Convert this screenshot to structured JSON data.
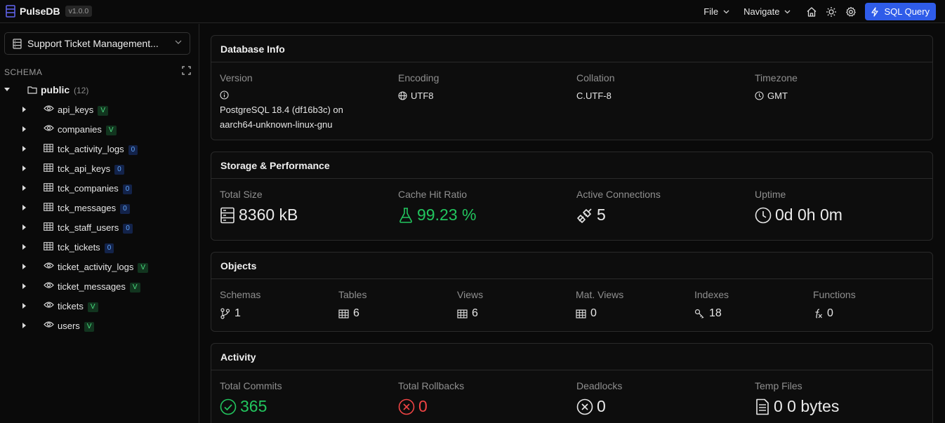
{
  "app": {
    "name": "PulseDB",
    "version": "v1.0.0"
  },
  "topnav": {
    "file": "File",
    "navigate": "Navigate",
    "sql_query": "SQL Query"
  },
  "sidebar": {
    "database": "Support Ticket Management...",
    "schema_heading": "SCHEMA",
    "schema": {
      "name": "public",
      "count": "(12)"
    },
    "items": [
      {
        "name": "api_keys",
        "type": "view",
        "badge": "V"
      },
      {
        "name": "companies",
        "type": "view",
        "badge": "V"
      },
      {
        "name": "tck_activity_logs",
        "type": "table",
        "badge": "0"
      },
      {
        "name": "tck_api_keys",
        "type": "table",
        "badge": "0"
      },
      {
        "name": "tck_companies",
        "type": "table",
        "badge": "0"
      },
      {
        "name": "tck_messages",
        "type": "table",
        "badge": "0"
      },
      {
        "name": "tck_staff_users",
        "type": "table",
        "badge": "0"
      },
      {
        "name": "tck_tickets",
        "type": "table",
        "badge": "0"
      },
      {
        "name": "ticket_activity_logs",
        "type": "view",
        "badge": "V"
      },
      {
        "name": "ticket_messages",
        "type": "view",
        "badge": "V"
      },
      {
        "name": "tickets",
        "type": "view",
        "badge": "V"
      },
      {
        "name": "users",
        "type": "view",
        "badge": "V"
      }
    ]
  },
  "database_info": {
    "title": "Database Info",
    "version_label": "Version",
    "version_line1": "PostgreSQL 18.4 (df16b3c) on",
    "version_line2": "aarch64-unknown-linux-gnu",
    "encoding_label": "Encoding",
    "encoding": "UTF8",
    "collation_label": "Collation",
    "collation": "C.UTF-8",
    "timezone_label": "Timezone",
    "timezone": "GMT"
  },
  "storage": {
    "title": "Storage & Performance",
    "total_size_label": "Total Size",
    "total_size": "8360 kB",
    "cache_hit_label": "Cache Hit Ratio",
    "cache_hit": "99.23 %",
    "connections_label": "Active Connections",
    "connections": "5",
    "uptime_label": "Uptime",
    "uptime": "0d 0h 0m"
  },
  "objects": {
    "title": "Objects",
    "schemas_label": "Schemas",
    "schemas": "1",
    "tables_label": "Tables",
    "tables": "6",
    "views_label": "Views",
    "views": "6",
    "matviews_label": "Mat. Views",
    "matviews": "0",
    "indexes_label": "Indexes",
    "indexes": "18",
    "functions_label": "Functions",
    "functions": "0"
  },
  "activity": {
    "title": "Activity",
    "commits_label": "Total Commits",
    "commits": "365",
    "rollbacks_label": "Total Rollbacks",
    "rollbacks": "0",
    "deadlocks_label": "Deadlocks",
    "deadlocks": "0",
    "temp_files_label": "Temp Files",
    "temp_files": "0 0 bytes"
  },
  "colors": {
    "accent": "#2f5ce9",
    "success": "#22c55e",
    "danger": "#ef4444",
    "view_badge": "#4ade80",
    "table_badge": "#60a5fa"
  }
}
